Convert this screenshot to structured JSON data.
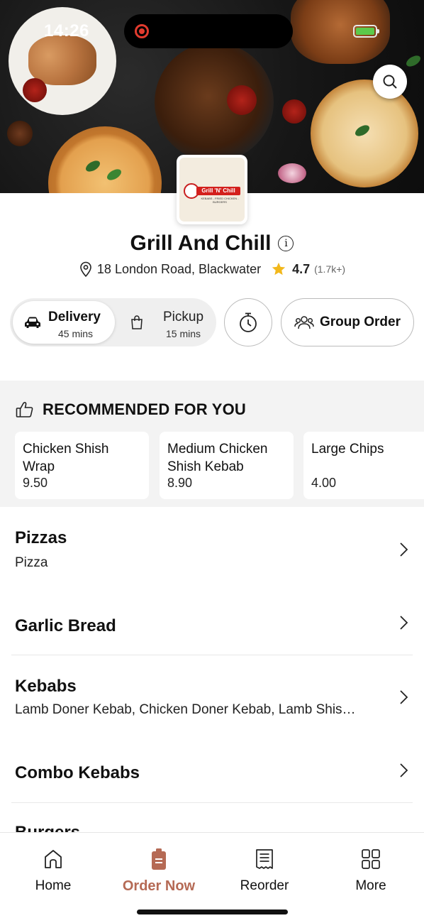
{
  "status_bar": {
    "time": "14:26"
  },
  "restaurant": {
    "name": "Grill And Chill",
    "logo_text": "Grill 'N' Chill",
    "logo_subtext": "KEBABS - FRIED CHICKEN - BURGERS",
    "address": "18 London Road, Blackwater",
    "rating": "4.7",
    "rating_count": "(1.7k+)"
  },
  "order_modes": {
    "delivery": {
      "label": "Delivery",
      "time": "45 mins",
      "selected": true
    },
    "pickup": {
      "label": "Pickup",
      "time": "15 mins",
      "selected": false
    }
  },
  "group_order_label": "Group Order",
  "recommended": {
    "title": "RECOMMENDED FOR YOU",
    "items": [
      {
        "name": "Chicken Shish Wrap",
        "price": "9.50"
      },
      {
        "name": "Medium Chicken Shish Kebab",
        "price": "8.90"
      },
      {
        "name": "Large Chips",
        "price": "4.00"
      }
    ]
  },
  "categories": [
    {
      "title": "Pizzas",
      "subtitle": "Pizza"
    },
    {
      "title": "Garlic Bread",
      "subtitle": ""
    },
    {
      "title": "Kebabs",
      "subtitle": "Lamb Doner Kebab, Chicken Doner Kebab, Lamb Shis…"
    },
    {
      "title": "Combo Kebabs",
      "subtitle": ""
    },
    {
      "title": "Burgers",
      "subtitle": ""
    }
  ],
  "tab_bar": {
    "items": [
      {
        "label": "Home",
        "icon": "home-icon"
      },
      {
        "label": "Order Now",
        "icon": "order-bag-icon",
        "active": true
      },
      {
        "label": "Reorder",
        "icon": "receipt-icon"
      },
      {
        "label": "More",
        "icon": "grid-icon"
      }
    ]
  },
  "colors": {
    "accent": "#b56a55",
    "star": "#f2b81c",
    "battery": "#5cc94a",
    "record": "#e23b2e",
    "logo_red": "#d3201d"
  }
}
